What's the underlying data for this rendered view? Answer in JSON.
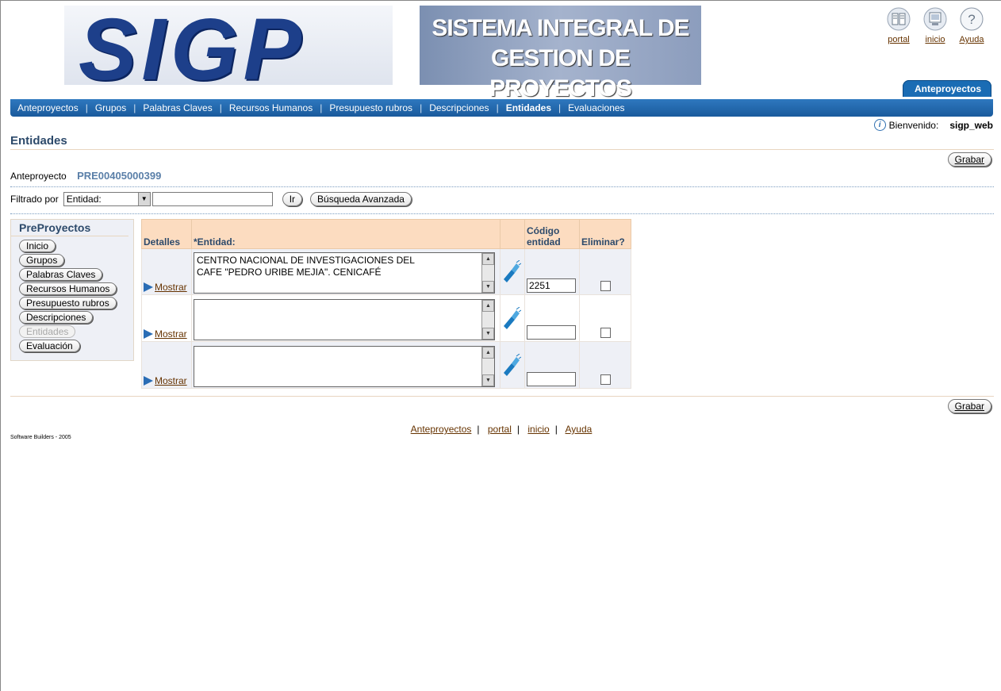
{
  "header": {
    "logo_text": "SIGP",
    "system_title_line1": "SISTEMA INTEGRAL DE",
    "system_title_line2": "GESTION DE PROYECTOS",
    "global_buttons": [
      {
        "label": "portal",
        "icon": "portal-book-icon"
      },
      {
        "label": "inicio",
        "icon": "home-screen-icon"
      },
      {
        "label": "Ayuda",
        "icon": "help-question-icon"
      }
    ],
    "active_tab": "Anteproyectos"
  },
  "navbar": {
    "items": [
      "Anteproyectos",
      "Grupos",
      "Palabras Claves",
      "Recursos Humanos",
      "Presupuesto rubros",
      "Descripciones",
      "Entidades",
      "Evaluaciones"
    ],
    "active": "Entidades"
  },
  "welcome": {
    "label": "Bienvenido:",
    "user": "sigp_web"
  },
  "page": {
    "title": "Entidades",
    "save_label": "Grabar",
    "anteproyecto_label": "Anteproyecto",
    "anteproyecto_value": "PRE00405000399"
  },
  "filter": {
    "label": "Filtrado por",
    "select_value": "Entidad:",
    "input_value": "",
    "go_label": "Ir",
    "advanced_label": "Búsqueda Avanzada"
  },
  "sidenav": {
    "title": "PreProyectos",
    "items": [
      {
        "label": "Inicio",
        "enabled": true
      },
      {
        "label": "Grupos",
        "enabled": true
      },
      {
        "label": "Palabras Claves",
        "enabled": true
      },
      {
        "label": "Recursos Humanos",
        "enabled": true
      },
      {
        "label": "Presupuesto rubros",
        "enabled": true
      },
      {
        "label": "Descripciones",
        "enabled": true
      },
      {
        "label": "Entidades",
        "enabled": false
      },
      {
        "label": "Evaluación",
        "enabled": true
      }
    ]
  },
  "table": {
    "headers": {
      "detalles": "Detalles",
      "required_mark": "*",
      "entidad": "Entidad:",
      "codigo_line1": "Código",
      "codigo_line2": "entidad",
      "eliminar": "Eliminar?"
    },
    "rows": [
      {
        "mostrar": "Mostrar",
        "entidad": "CENTRO NACIONAL DE INVESTIGACIONES DEL\nCAFE \"PEDRO URIBE MEJIA\". CENICAFÉ",
        "codigo": "2251",
        "eliminar": false
      },
      {
        "mostrar": "Mostrar",
        "entidad": "",
        "codigo": "",
        "eliminar": false
      },
      {
        "mostrar": "Mostrar",
        "entidad": "",
        "codigo": "",
        "eliminar": false
      }
    ]
  },
  "footer": {
    "links": [
      "Anteproyectos",
      "portal",
      "inicio",
      "Ayuda"
    ],
    "copyright": "Software Builders - 2005"
  },
  "colors": {
    "navbar": "#1a5a9c",
    "title": "#2d4a6b",
    "table_header": "#fcdcc0",
    "link": "#663300"
  }
}
